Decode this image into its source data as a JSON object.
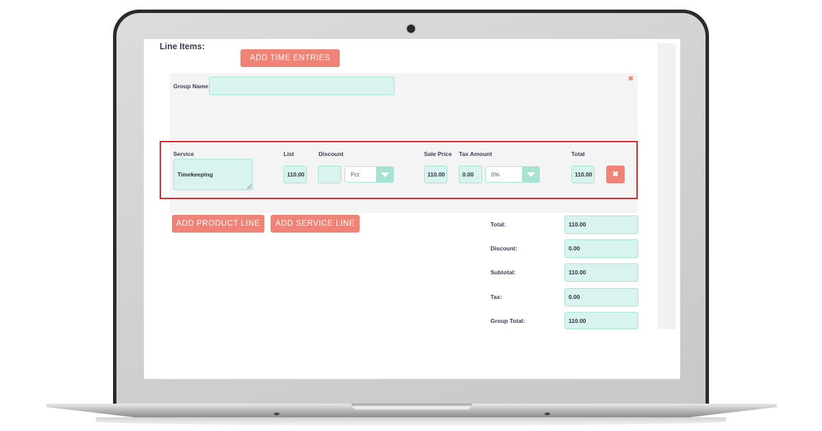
{
  "line_items": {
    "heading": "Line Items:",
    "add_time_entries_label": "ADD TIME ENTRIES",
    "group": {
      "name_label": "Group Name:",
      "name_value": "",
      "remove_icon": "close-icon",
      "columns": {
        "service": "Service",
        "list": "List",
        "discount": "Discount",
        "sale_price": "Sale Price",
        "tax_amount": "Tax Amount",
        "total": "Total"
      },
      "row": {
        "service": "Timekeeping",
        "list": "110.00",
        "discount": "",
        "discount_type": "Pct",
        "sale_price": "110.00",
        "tax_amount": "0.00",
        "tax_rate": "0%",
        "total": "110.00",
        "delete_icon": "close-icon"
      }
    },
    "add_product_line_label": "ADD PRODUCT LINE",
    "add_service_line_label": "ADD SERVICE LINE",
    "summary": [
      {
        "label": "Total:",
        "value": "110.00"
      },
      {
        "label": "Discount:",
        "value": "0.00"
      },
      {
        "label": "Subtotal:",
        "value": "110.00"
      },
      {
        "label": "Tax:",
        "value": "0.00"
      },
      {
        "label": "Group Total:",
        "value": "110.00"
      }
    ]
  },
  "colors": {
    "accent": "#f08377",
    "field_bg": "#d9f4ee",
    "field_border": "#a7e3d3",
    "highlight": "#e2232a"
  }
}
